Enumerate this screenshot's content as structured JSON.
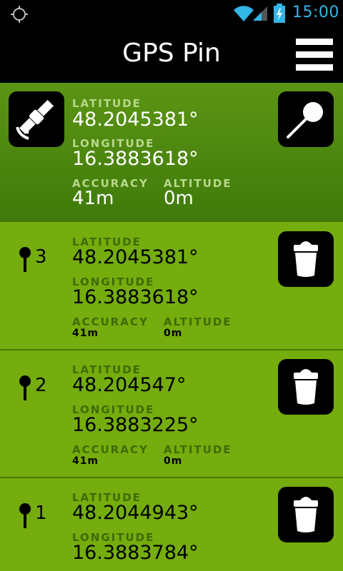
{
  "status_bar": {
    "time": "15:00"
  },
  "header": {
    "title": "GPS Pin"
  },
  "current": {
    "latitude_label": "LATITUDE",
    "latitude": "48.2045381°",
    "longitude_label": "LONGITUDE",
    "longitude": "16.3883618°",
    "accuracy_label": "ACCURACY",
    "accuracy": "41m",
    "altitude_label": "ALTITUDE",
    "altitude": "0m"
  },
  "pins": [
    {
      "number": "3",
      "latitude_label": "LATITUDE",
      "latitude": "48.2045381°",
      "longitude_label": "LONGITUDE",
      "longitude": "16.3883618°",
      "accuracy_label": "ACCURACY",
      "accuracy": "41m",
      "altitude_label": "ALTITUDE",
      "altitude": "0m"
    },
    {
      "number": "2",
      "latitude_label": "LATITUDE",
      "latitude": "48.204547°",
      "longitude_label": "LONGITUDE",
      "longitude": "16.3883225°",
      "accuracy_label": "ACCURACY",
      "accuracy": "41m",
      "altitude_label": "ALTITUDE",
      "altitude": "0m"
    },
    {
      "number": "1",
      "latitude_label": "LATITUDE",
      "latitude": "48.2044943°",
      "longitude_label": "LONGITUDE",
      "longitude": "16.3883784°"
    }
  ],
  "icons": {
    "status_gps": "crosshair-icon",
    "wifi": "wifi-icon",
    "signal": "signal-icon",
    "battery": "battery-charging-icon",
    "menu": "hamburger-menu-icon",
    "satellite": "satellite-icon",
    "pin": "pushpin-icon",
    "delete": "trash-icon"
  },
  "colors": {
    "status_time": "#33b5e5",
    "current_bg": "#4f8811",
    "row_bg": "#74ad0d",
    "label_on_dark": "#b7d98a",
    "label_on_light": "#3f6b06"
  }
}
